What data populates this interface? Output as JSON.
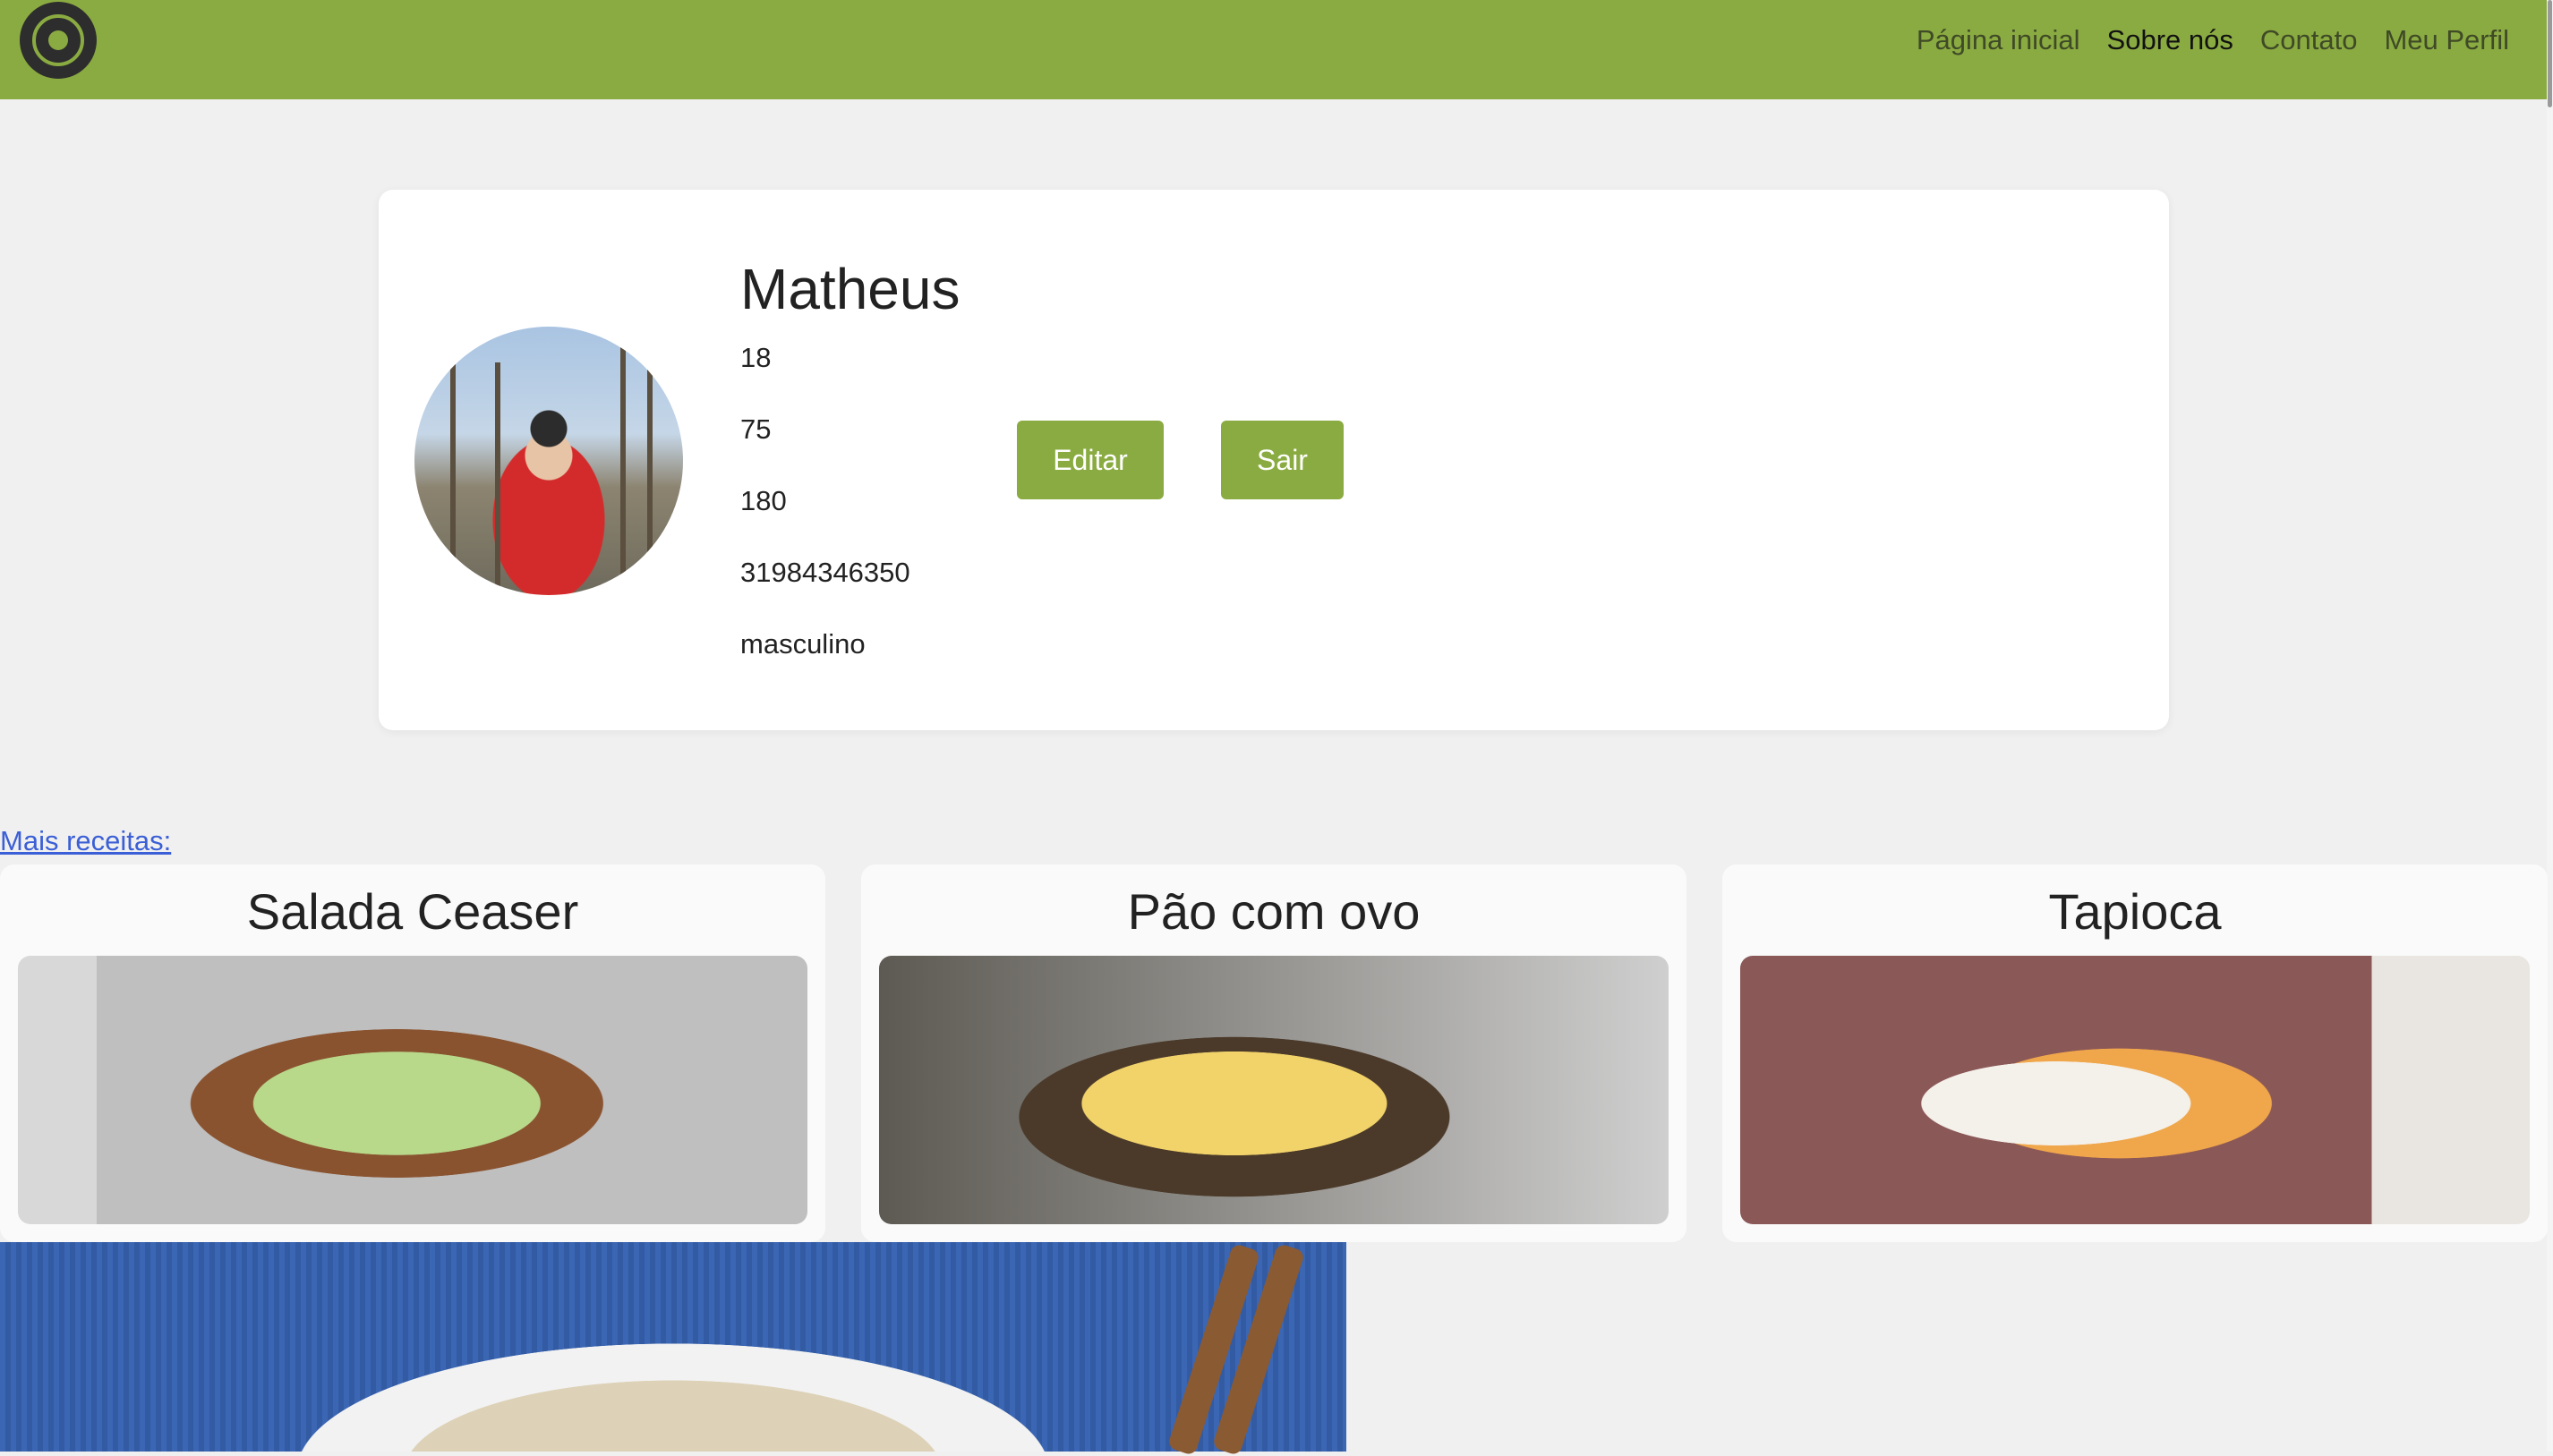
{
  "nav": {
    "logo_alt": "logo",
    "links": [
      "Página inicial",
      "Sobre nós",
      "Contato",
      "Meu Perfil"
    ]
  },
  "profile": {
    "name": "Matheus",
    "age": "18",
    "weight": "75",
    "height": "180",
    "phone": "31984346350",
    "gender": "masculino",
    "edit_label": "Editar",
    "logout_label": "Sair"
  },
  "recipes_section": {
    "link_label": "Mais receitas:",
    "cards": [
      {
        "title": "Salada Ceaser"
      },
      {
        "title": "Pão com ovo"
      },
      {
        "title": "Tapioca"
      }
    ]
  },
  "colors": {
    "accent": "#8aab41",
    "link": "#3b5fd6",
    "background": "#f0f0f0"
  }
}
